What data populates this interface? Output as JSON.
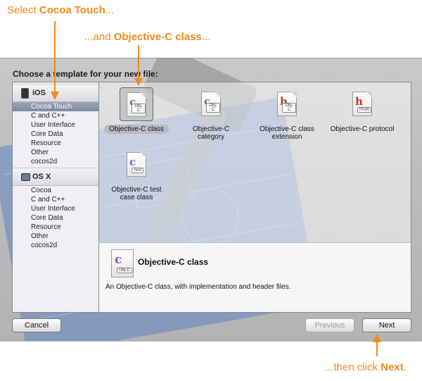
{
  "callouts": {
    "top": {
      "pre": "Select ",
      "bold": "Cocoa Touch",
      "post": "..."
    },
    "middle": {
      "pre": "...and ",
      "bold": "Objective-C class",
      "post": "..."
    },
    "bottom": {
      "pre": "...then click ",
      "bold": "Next",
      "post": "."
    }
  },
  "colors": {
    "callout": "#f08a1c",
    "selection": "#8894a8"
  },
  "dialog": {
    "prompt": "Choose a template for your new file:"
  },
  "sidebar": {
    "groups": [
      {
        "title": "iOS",
        "icon": "iphone-icon",
        "items": [
          "Cocoa Touch",
          "C and C++",
          "User Interface",
          "Core Data",
          "Resource",
          "Other",
          "cocos2d"
        ]
      },
      {
        "title": "OS X",
        "icon": "mac-monitor-icon",
        "items": [
          "Cocoa",
          "C and C++",
          "User Interface",
          "Core Data",
          "Resource",
          "Other",
          "cocos2d"
        ]
      }
    ],
    "selected": "Cocoa Touch"
  },
  "templates": [
    {
      "label": "Objective-C class",
      "glyph": "c",
      "tag": "Obj-C",
      "selected": true
    },
    {
      "label": "Objective-C category",
      "glyph": "c",
      "tag": "Obj-C",
      "selected": false
    },
    {
      "label": "Objective-C class extension",
      "glyph": "h",
      "tag": "Obj-C",
      "selected": false
    },
    {
      "label": "Objective-C protocol",
      "glyph": "h",
      "tag": "Proto",
      "selected": false
    },
    {
      "label": "Objective-C test case class",
      "glyph": "c",
      "tag": "Test",
      "selected": false
    }
  ],
  "detail": {
    "title": "Objective-C class",
    "tag": "Obj-C",
    "glyph": "c",
    "description": "An Objective-C class, with implementation and header files."
  },
  "buttons": {
    "cancel": "Cancel",
    "previous": "Previous",
    "next": "Next"
  }
}
